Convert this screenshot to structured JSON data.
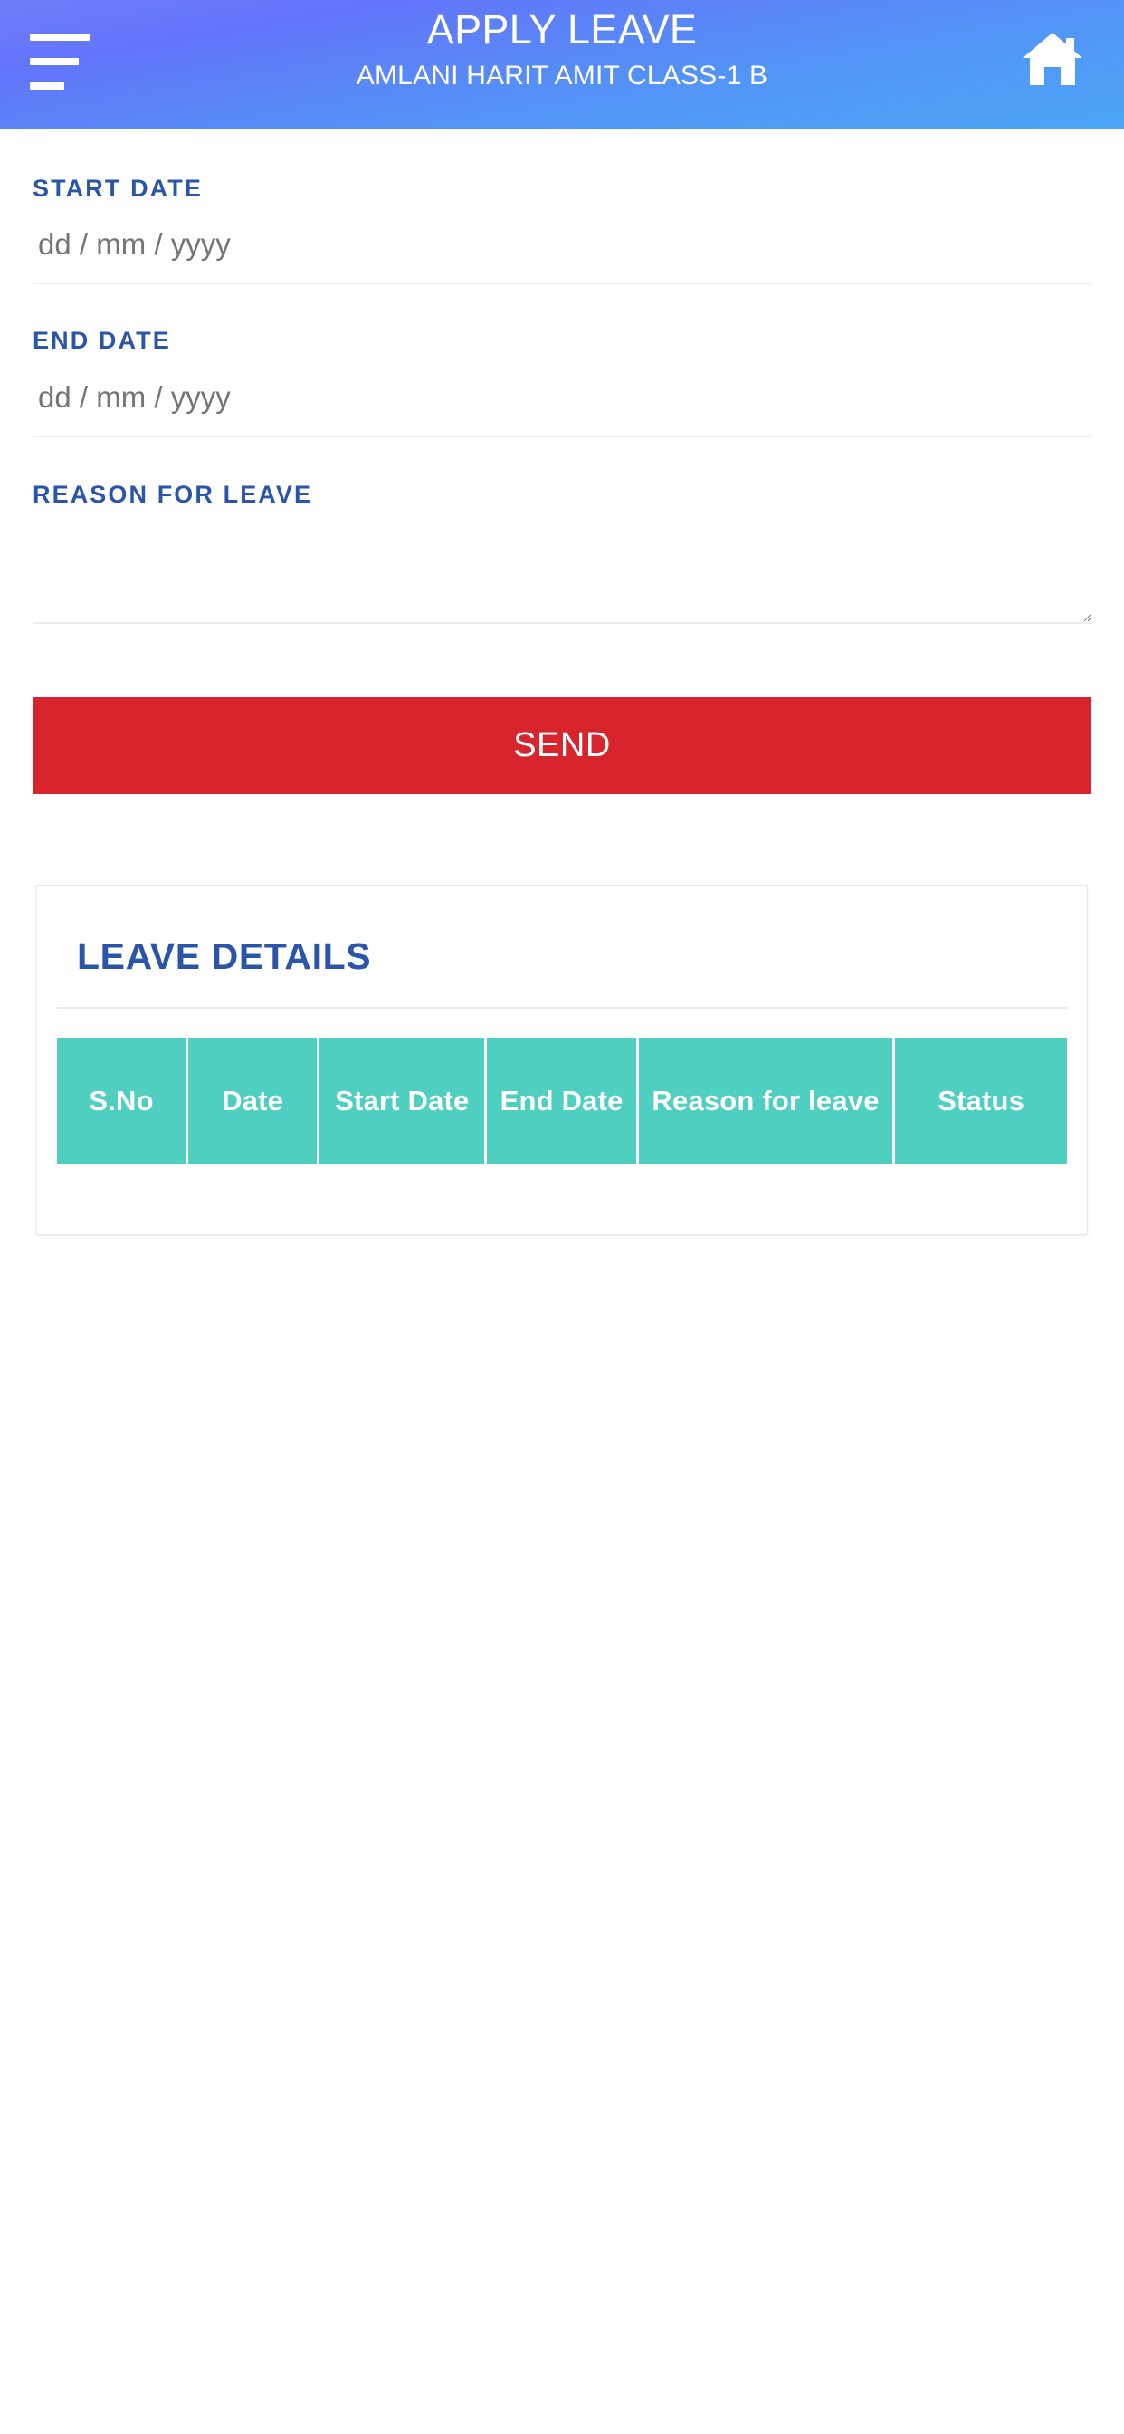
{
  "appbar": {
    "menu_icon": "hamburger-menu-icon",
    "title": "APPLY LEAVE",
    "subtitle": "AMLANI HARIT AMIT CLASS-1 B",
    "home_icon": "home-icon",
    "gradient_from": "#6F7DFB",
    "gradient_to": "#4BA6F6"
  },
  "form": {
    "start_date": {
      "label": "START DATE",
      "value": "",
      "placeholder": "dd / mm / yyyy"
    },
    "end_date": {
      "label": "END DATE",
      "value": "",
      "placeholder": "dd / mm / yyyy"
    },
    "reason": {
      "label": "REASON FOR LEAVE",
      "value": "",
      "placeholder": ""
    },
    "submit": {
      "label": "SEND",
      "color": "#D8242C"
    },
    "label_color": "#2B55A8"
  },
  "leave_details": {
    "title": "LEAVE DETAILS",
    "header_color": "#4ECFBF",
    "columns": [
      {
        "key": "sno",
        "label": "S.No"
      },
      {
        "key": "date",
        "label": "Date"
      },
      {
        "key": "start_date",
        "label": "Start Date"
      },
      {
        "key": "end_date",
        "label": "End Date"
      },
      {
        "key": "reason",
        "label": "Reason for leave"
      },
      {
        "key": "status",
        "label": "Status"
      }
    ],
    "rows": []
  }
}
